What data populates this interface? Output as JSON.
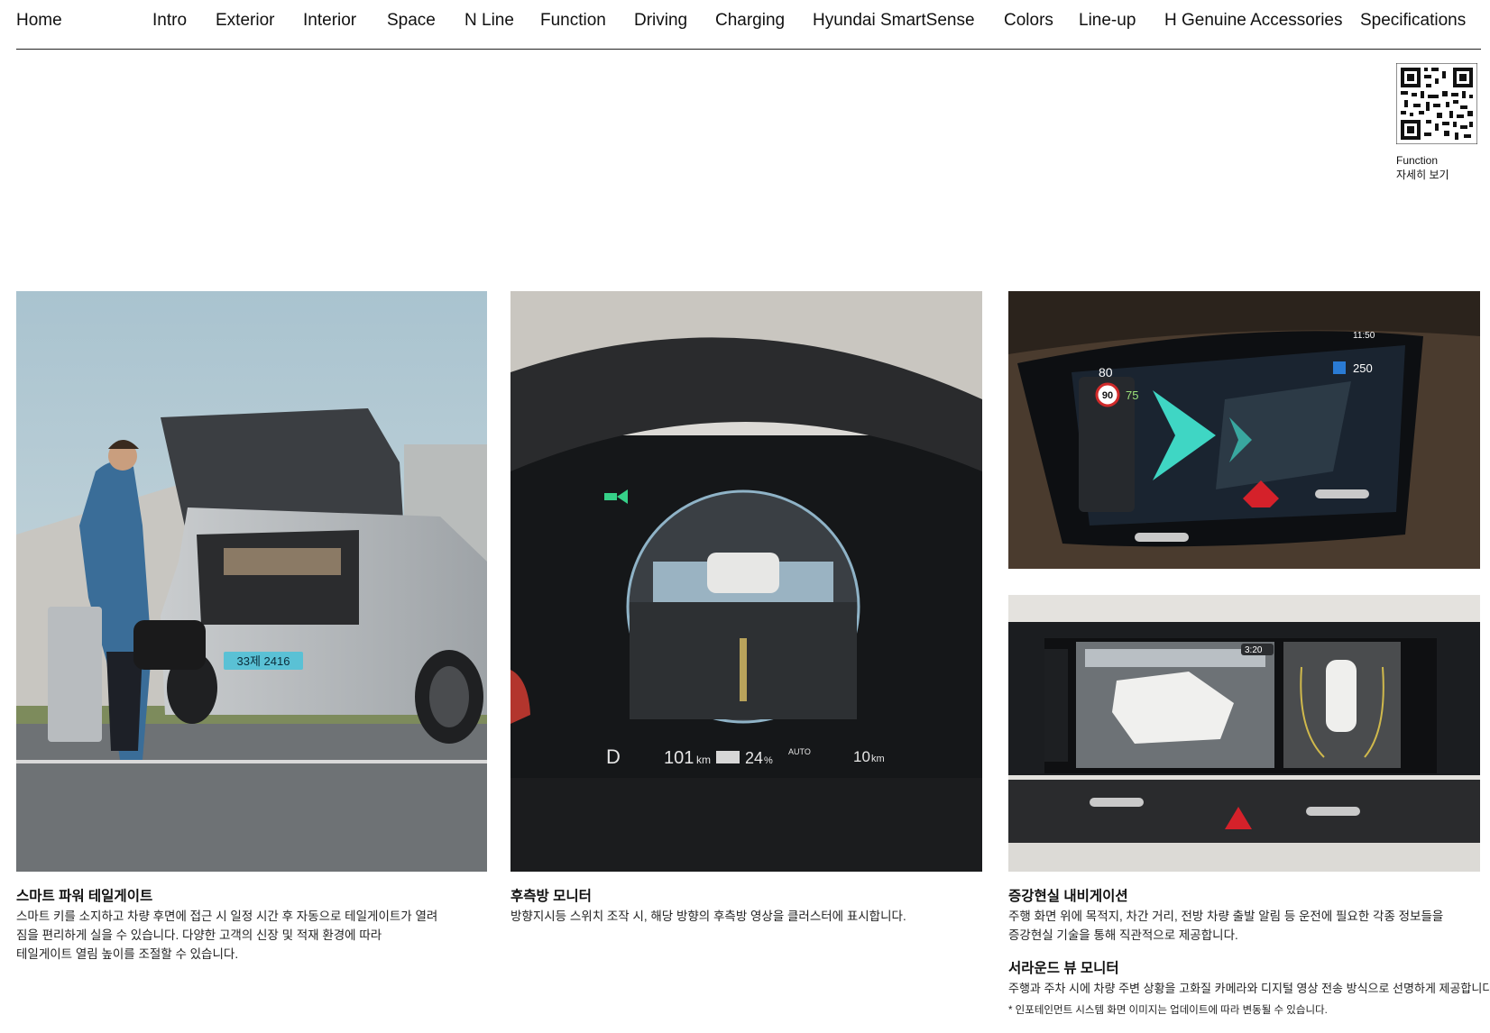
{
  "nav": {
    "home": "Home",
    "items": [
      "Intro",
      "Exterior",
      "Interior",
      "Space",
      "N Line",
      "Function",
      "Driving",
      "Charging",
      "Hyundai SmartSense",
      "Colors",
      "Line-up",
      "H Genuine Accessories",
      "Specifications"
    ]
  },
  "qr": {
    "line1": "Function",
    "line2": "자세히 보기"
  },
  "features": [
    {
      "title": "스마트 파워 테일게이트",
      "lines": [
        "스마트 키를 소지하고 차량 후면에 접근 시 일정 시간 후 자동으로 테일게이트가 열려",
        "짐을 편리하게 실을 수 있습니다. 다양한 고객의 신장 및 적재 환경에 따라",
        "테일게이트 열림 높이를 조절할 수 있습니다."
      ],
      "plate": "33제 2416"
    },
    {
      "title": "후측방 모니터",
      "lines": [
        "방향지시등 스위치 조작 시, 해당 방향의 후측방 영상을 클러스터에 표시합니다."
      ],
      "gear": "D",
      "range": "101",
      "range_unit": "km",
      "battery": "24",
      "battery_unit": "%",
      "mode": "AUTO",
      "trip": "10",
      "trip_unit": "km"
    },
    {
      "title": "증강현실 내비게이션",
      "lines": [
        "주행 화면 위에 목적지, 차간 거리, 전방 차량 출발 알림 등 운전에 필요한 각종 정보들을",
        "증강현실 기술을 통해 직관적으로 제공합니다."
      ],
      "speed": "80",
      "limit": "90",
      "set_speed": "75",
      "time": "11:50",
      "dist": "250"
    },
    {
      "title": "서라운드 뷰 모니터",
      "lines": [
        "주행과 주차 시에 차량 주변 상황을 고화질 카메라와 디지털 영상 전송 방식으로 선명하게 제공합니다."
      ],
      "note": "* 인포테인먼트 시스템 화면 이미지는 업데이트에 따라 변동될 수 있습니다.",
      "time": "3:20"
    }
  ]
}
